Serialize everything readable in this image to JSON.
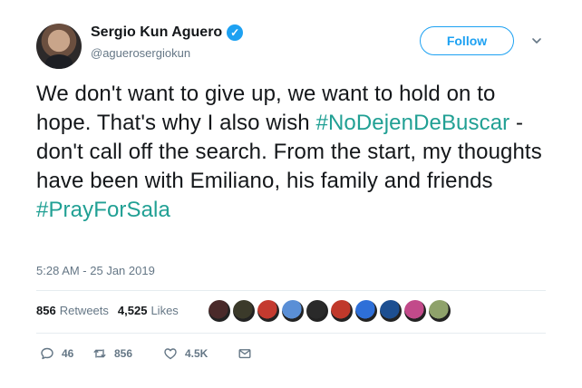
{
  "tweet": {
    "display_name": "Sergio Kun Aguero",
    "handle": "@aguerosergiokun",
    "follow_label": "Follow",
    "text_parts": {
      "p1": "We don't want to give up, we want to hold on to hope. That's why I also wish ",
      "h1": "#NoDejenDeBuscar",
      "p2": " - don't call off the search. From the start, my thoughts have been with Emiliano, his family and friends ",
      "h2": "#PrayForSala"
    },
    "timestamp": "5:28 AM - 25 Jan 2019"
  },
  "stats": {
    "retweets_count": "856",
    "retweets_label": "Retweets",
    "likes_count": "4,525",
    "likes_label": "Likes"
  },
  "likers_colors": [
    "#4a2a2a",
    "#3b3a2a",
    "#c43a2f",
    "#5a8fd6",
    "#2a2a2a",
    "#c0392b",
    "#2e6fd8",
    "#1d4f91",
    "#c24a8a",
    "#8fa26b"
  ],
  "actions": {
    "reply_count": "46",
    "retweet_count": "856",
    "like_count": "4.5K"
  },
  "icons": {
    "verified": "verified-badge-icon",
    "caret": "chevron-down-icon",
    "reply": "reply-icon",
    "retweet": "retweet-icon",
    "like": "heart-icon",
    "dm": "envelope-icon"
  },
  "colors": {
    "brand_blue": "#1da1f2",
    "hashtag": "#21a094",
    "secondary_text": "#657786"
  }
}
